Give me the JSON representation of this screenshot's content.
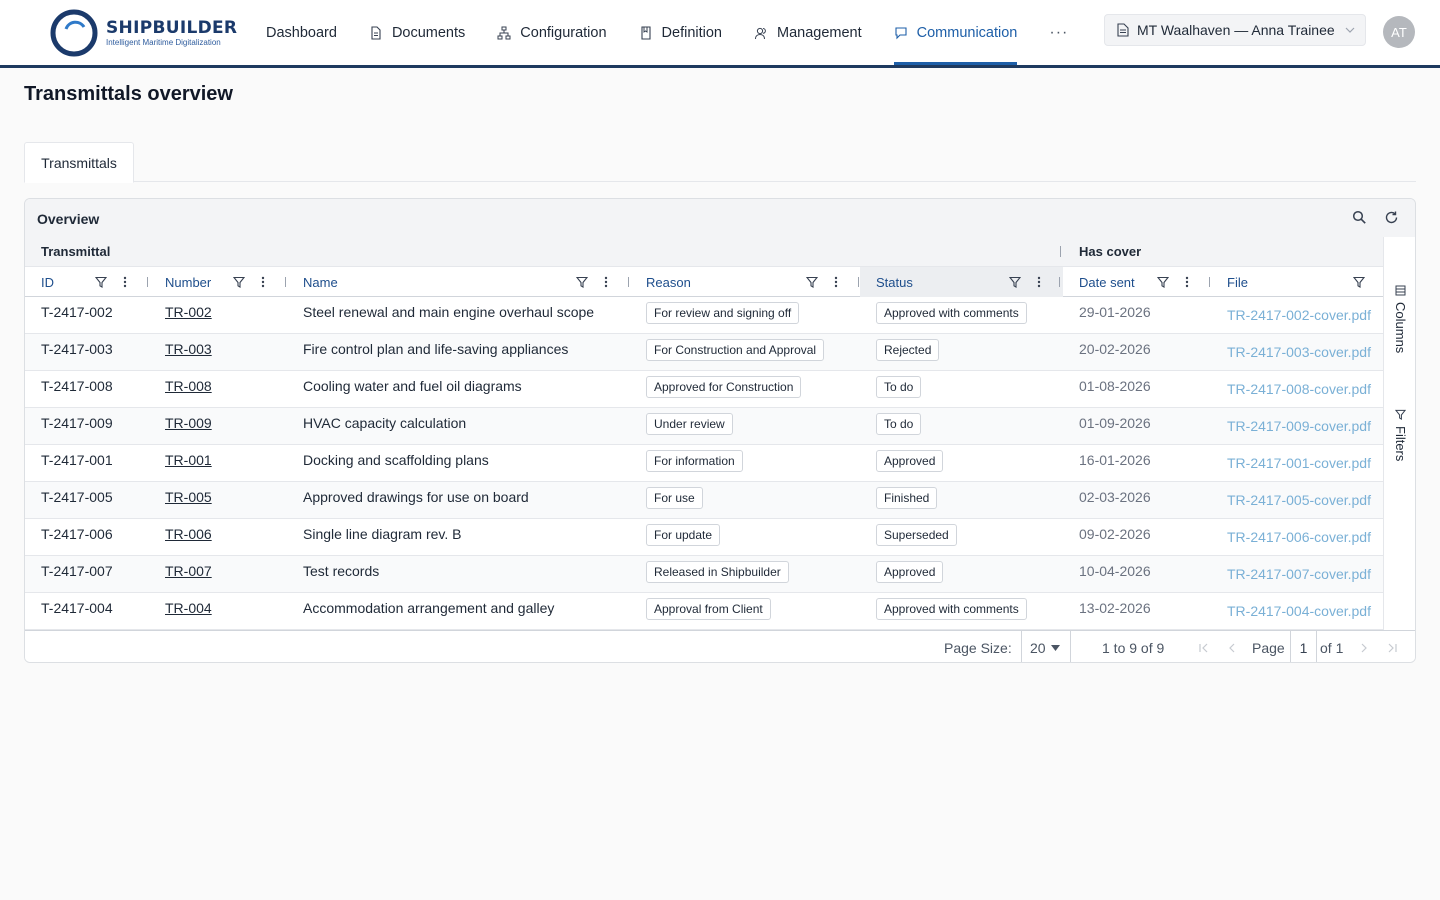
{
  "brand": {
    "name": "SHIPBUILDER",
    "tagline": "Intelligent Maritime Digitalization"
  },
  "nav": {
    "items": [
      {
        "label": "Dashboard",
        "icon": "none"
      },
      {
        "label": "Documents",
        "icon": "document-icon"
      },
      {
        "label": "Configuration",
        "icon": "hierarchy-icon"
      },
      {
        "label": "Definition",
        "icon": "bookmark-icon"
      },
      {
        "label": "Management",
        "icon": "users-icon"
      },
      {
        "label": "Communication",
        "icon": "chat-icon",
        "active": true
      }
    ],
    "more": "···"
  },
  "project_selector": {
    "value": "MT Waalhaven — Anna Trainee"
  },
  "user": {
    "initials": "AT"
  },
  "page": {
    "title": "Transmittals overview"
  },
  "tabs": [
    {
      "label": "Transmittals",
      "active": true
    }
  ],
  "panel": {
    "title": "Overview",
    "groups": {
      "transmittal": "Transmittal",
      "has_cover": "Has cover"
    },
    "columns": [
      "ID",
      "Number",
      "Name",
      "Reason",
      "Status",
      "Date sent",
      "File"
    ],
    "side": {
      "columns": "Columns",
      "filters": "Filters"
    }
  },
  "rows": [
    {
      "id": "T-2417-002",
      "number": "TR-002",
      "name": "Steel renewal and main engine overhaul scope",
      "reason": "For review and signing off",
      "status": "Approved with comments",
      "date": "29-01-2026",
      "file": "TR-2417-002-cover.pdf"
    },
    {
      "id": "T-2417-003",
      "number": "TR-003",
      "name": "Fire control plan and life-saving appliances",
      "reason": "For Construction and Approval",
      "status": "Rejected",
      "date": "20-02-2026",
      "file": "TR-2417-003-cover.pdf"
    },
    {
      "id": "T-2417-008",
      "number": "TR-008",
      "name": "Cooling water and fuel oil diagrams",
      "reason": "Approved for Construction",
      "status": "To do",
      "date": "01-08-2026",
      "file": "TR-2417-008-cover.pdf"
    },
    {
      "id": "T-2417-009",
      "number": "TR-009",
      "name": "HVAC capacity calculation",
      "reason": "Under review",
      "status": "To do",
      "date": "01-09-2026",
      "file": "TR-2417-009-cover.pdf"
    },
    {
      "id": "T-2417-001",
      "number": "TR-001",
      "name": "Docking and scaffolding plans",
      "reason": "For information",
      "status": "Approved",
      "date": "16-01-2026",
      "file": "TR-2417-001-cover.pdf"
    },
    {
      "id": "T-2417-005",
      "number": "TR-005",
      "name": "Approved drawings for use on board",
      "reason": "For use",
      "status": "Finished",
      "date": "02-03-2026",
      "file": "TR-2417-005-cover.pdf"
    },
    {
      "id": "T-2417-006",
      "number": "TR-006",
      "name": "Single line diagram rev. B",
      "reason": "For update",
      "status": "Superseded",
      "date": "09-02-2026",
      "file": "TR-2417-006-cover.pdf"
    },
    {
      "id": "T-2417-007",
      "number": "TR-007",
      "name": "Test records",
      "reason": "Released in Shipbuilder",
      "status": "Approved",
      "date": "10-04-2026",
      "file": "TR-2417-007-cover.pdf"
    },
    {
      "id": "T-2417-004",
      "number": "TR-004",
      "name": "Accommodation arrangement and galley",
      "reason": "Approval from Client",
      "status": "Approved with comments",
      "date": "13-02-2026",
      "file": "TR-2417-004-cover.pdf"
    }
  ],
  "pagination": {
    "page_size_label": "Page Size:",
    "page_size": "20",
    "range": "1 to 9 of 9",
    "page_label": "Page",
    "page": "1",
    "of": "of 1"
  },
  "colors": {
    "brand": "#1b3a6b",
    "accent": "#1e5fa8",
    "file_link": "#7ab0d6"
  }
}
